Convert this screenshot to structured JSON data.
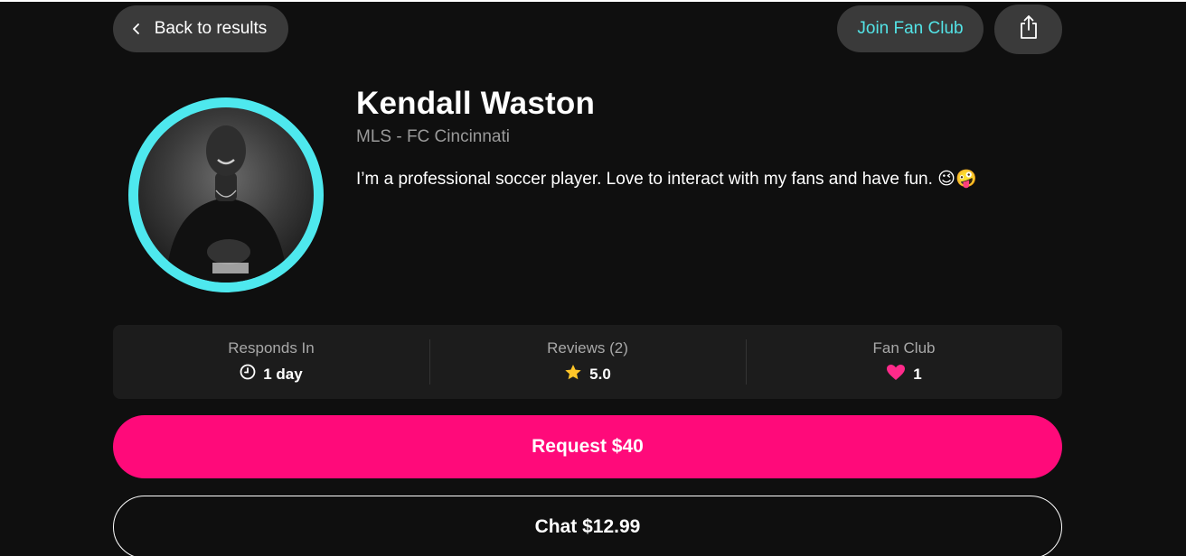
{
  "header": {
    "back_label": "Back to results",
    "join_label": "Join Fan Club",
    "share_icon": "share-icon"
  },
  "profile": {
    "name": "Kendall Waston",
    "league": "MLS - FC Cincinnati",
    "bio": "I’m a professional soccer player. Love to interact with my fans and have fun. 😉🤪",
    "ring_color": "#4ee8ee"
  },
  "stats": {
    "responds": {
      "label": "Responds In",
      "value": "1 day",
      "icon": "clock-icon"
    },
    "reviews": {
      "label": "Reviews (2)",
      "value": "5.0",
      "icon": "star-icon"
    },
    "fanclub": {
      "label": "Fan Club",
      "value": "1",
      "icon": "heart-icon"
    }
  },
  "actions": {
    "request_label": "Request $40",
    "chat_label": "Chat $12.99"
  },
  "colors": {
    "background": "#0f0f0f",
    "accent_pink": "#ff0a7a",
    "accent_cyan": "#53e3e6",
    "star": "#ffc629"
  }
}
